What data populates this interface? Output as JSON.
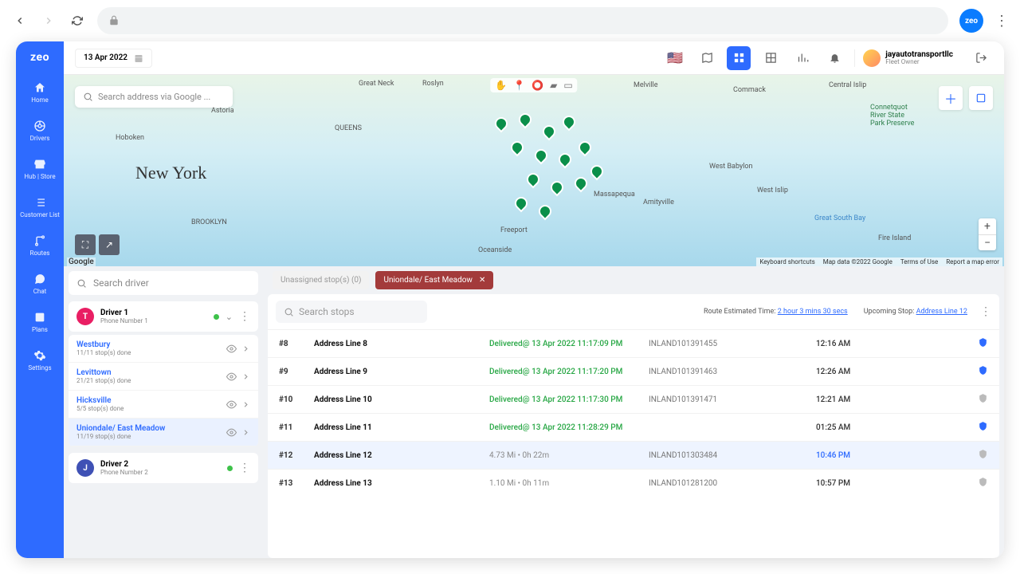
{
  "browser": {
    "badge": "zeo"
  },
  "app": {
    "logo": "zeo",
    "date": "13 Apr 2022"
  },
  "sidenav": [
    {
      "label": "Home",
      "icon": "home"
    },
    {
      "label": "Drivers",
      "icon": "wheel"
    },
    {
      "label": "Hub | Store",
      "icon": "store"
    },
    {
      "label": "Customer List",
      "icon": "list"
    },
    {
      "label": "Routes",
      "icon": "route"
    },
    {
      "label": "Chat",
      "icon": "chat"
    },
    {
      "label": "Plans",
      "icon": "plans"
    },
    {
      "label": "Settings",
      "icon": "gear"
    }
  ],
  "topbar": {
    "user_name": "jayautotransportllc",
    "user_role": "Fleet Owner"
  },
  "map": {
    "search_placeholder": "Search address via Google ...",
    "big_label": "New York",
    "google": "Google",
    "attrib_shortcuts": "Keyboard shortcuts",
    "attrib_data": "Map data ©2022 Google",
    "attrib_terms": "Terms of Use",
    "attrib_error": "Report a map error"
  },
  "left": {
    "search_driver_placeholder": "Search driver",
    "drivers": [
      {
        "initial": "T",
        "name": "Driver 1",
        "sub": "Phone Number 1"
      },
      {
        "initial": "J",
        "name": "Driver 2",
        "sub": "Phone Number 2"
      }
    ],
    "routes": [
      {
        "name": "Westbury",
        "sub": "11/11 stop(s) done",
        "active": false
      },
      {
        "name": "Levittown",
        "sub": "21/21 stop(s) done",
        "active": false
      },
      {
        "name": "Hicksville",
        "sub": "5/5 stop(s) done",
        "active": false
      },
      {
        "name": "Uniondale/ East Meadow",
        "sub": "11/19 stop(s) done",
        "active": true
      }
    ]
  },
  "right": {
    "unassigned_label": "Unassigned stop(s) (0)",
    "route_chip": "Uniondale/ East Meadow",
    "search_stops_placeholder": "Search stops",
    "est_label": "Route Estimated Time:",
    "est_value": "2 hour 3 mins 30 secs",
    "upcoming_label": "Upcoming Stop:",
    "upcoming_value": "Address Line 12"
  },
  "stops": [
    {
      "idx": "#8",
      "addr": "Address Line 8",
      "status": "Delivered@ 13 Apr 2022 11:17:09 PM",
      "delivered": true,
      "code": "INLAND101391455",
      "time": "12:16 AM",
      "shield": "blue"
    },
    {
      "idx": "#9",
      "addr": "Address Line 9",
      "status": "Delivered@ 13 Apr 2022 11:17:20 PM",
      "delivered": true,
      "code": "INLAND101391463",
      "time": "12:26 AM",
      "shield": "blue"
    },
    {
      "idx": "#10",
      "addr": "Address Line 10",
      "status": "Delivered@ 13 Apr 2022 11:17:30 PM",
      "delivered": true,
      "code": "INLAND101391471",
      "time": "12:21 AM",
      "shield": "gray"
    },
    {
      "idx": "#11",
      "addr": "Address Line 11",
      "status": "Delivered@ 13 Apr 2022 11:28:29 PM",
      "delivered": true,
      "code": "",
      "time": "01:25 AM",
      "shield": "blue"
    },
    {
      "idx": "#12",
      "addr": "Address Line 12",
      "status": "4.73 Mi • 0h 22m",
      "delivered": false,
      "code": "INLAND101303484",
      "time": "10:46 PM",
      "time_blue": true,
      "highlight": true,
      "shield": "gray"
    },
    {
      "idx": "#13",
      "addr": "Address Line 13",
      "status": "1.10 Mi • 0h 11m",
      "delivered": false,
      "code": "INLAND101281200",
      "time": "10:57 PM",
      "shield": "gray"
    }
  ]
}
